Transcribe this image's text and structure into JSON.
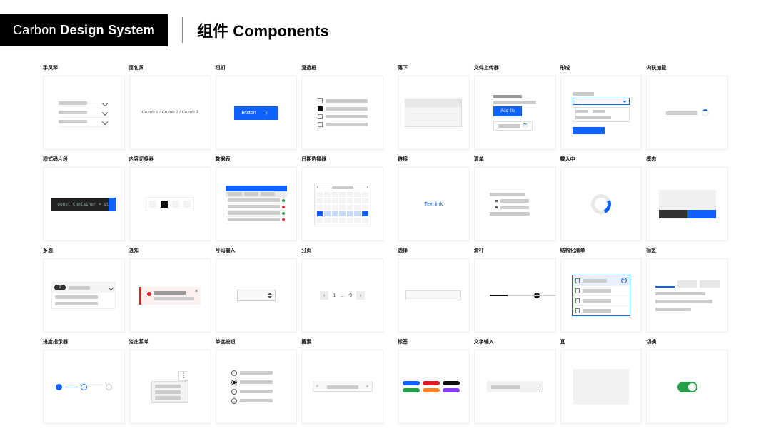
{
  "header": {
    "logo_light": "Carbon ",
    "logo_bold": "Design System",
    "title": "组件 Components"
  },
  "components": [
    {
      "label": "手风琴"
    },
    {
      "label": "面包屑",
      "crumb": "Crumb 1  /  Crumb 2  /  Crumb 3"
    },
    {
      "label": "纽扣",
      "button": "Button"
    },
    {
      "label": "复选框"
    },
    {
      "label": "落下"
    },
    {
      "label": "文件上传器",
      "addfile": "Add file"
    },
    {
      "label": "形成"
    },
    {
      "label": "内联加载"
    },
    {
      "label": "程式码片段",
      "code": "const Container = st"
    },
    {
      "label": "内容切换器"
    },
    {
      "label": "数据表"
    },
    {
      "label": "日期选择器"
    },
    {
      "label": "链接",
      "link": "Text link"
    },
    {
      "label": "清单"
    },
    {
      "label": "载入中"
    },
    {
      "label": "模态"
    },
    {
      "label": "多选",
      "badge": "2"
    },
    {
      "label": "通知"
    },
    {
      "label": "号码输入"
    },
    {
      "label": "分页",
      "p1": "1",
      "pd": "…",
      "p9": "9"
    },
    {
      "label": "选择"
    },
    {
      "label": "滑杆"
    },
    {
      "label": "结构化清单"
    },
    {
      "label": "标签"
    },
    {
      "label": "进度指示器"
    },
    {
      "label": "溢出菜单"
    },
    {
      "label": "单选按钮"
    },
    {
      "label": "搜索",
      "sicon": "⌕",
      "xicon": "×"
    },
    {
      "label": "标签"
    },
    {
      "label": "文字输入"
    },
    {
      "label": "瓦"
    },
    {
      "label": "切换"
    }
  ]
}
